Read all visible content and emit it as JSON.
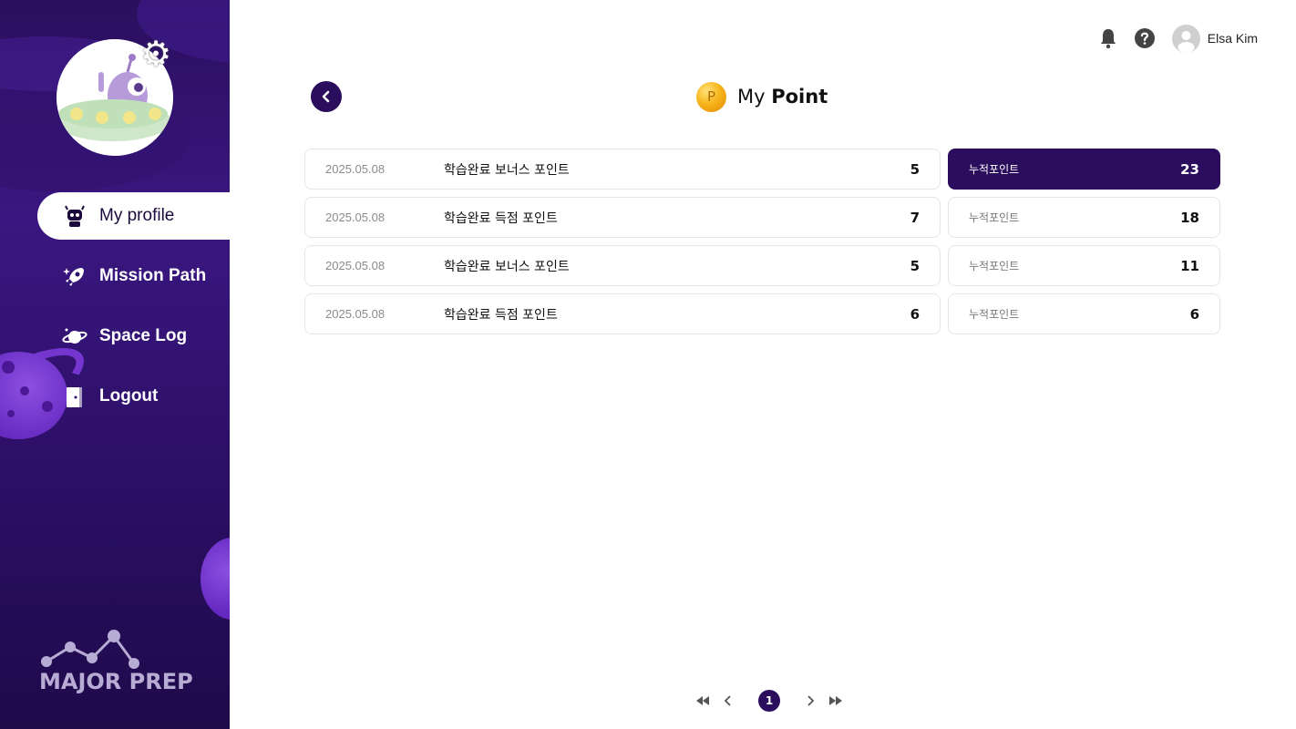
{
  "sidebar": {
    "items": [
      {
        "label": "My profile",
        "icon": "robot-icon",
        "active": true
      },
      {
        "label": "Mission Path",
        "icon": "rocket-icon",
        "active": false
      },
      {
        "label": "Space Log",
        "icon": "planet-icon",
        "active": false
      },
      {
        "label": "Logout",
        "icon": "door-icon",
        "active": false
      }
    ],
    "brand": "MAJOR PREP"
  },
  "topbar": {
    "user_name": "Elsa Kim",
    "icons": [
      "bell-icon",
      "help-icon",
      "user-avatar-icon"
    ]
  },
  "header": {
    "title_prefix": "My",
    "title_bold": "Point",
    "coin_letter": "P"
  },
  "history": [
    {
      "date": "2025.05.08",
      "desc": "학습완료 보너스 포인트",
      "points": "5"
    },
    {
      "date": "2025.05.08",
      "desc": "학습완료 득점 포인트",
      "points": "7"
    },
    {
      "date": "2025.05.08",
      "desc": "학습완료 보너스 포인트",
      "points": "5"
    },
    {
      "date": "2025.05.08",
      "desc": "학습완료 득점 포인트",
      "points": "6"
    }
  ],
  "totals": [
    {
      "label": "누적포인트",
      "value": "23",
      "highlight": true
    },
    {
      "label": "누적포인트",
      "value": "18",
      "highlight": false
    },
    {
      "label": "누적포인트",
      "value": "11",
      "highlight": false
    },
    {
      "label": "누적포인트",
      "value": "6",
      "highlight": false
    }
  ],
  "pagination": {
    "current_page": "1"
  },
  "colors": {
    "primary": "#2a0d5c",
    "sidebar_bg": "#3a1780",
    "coin": "#f7b51c",
    "border": "#e6e6ea"
  }
}
